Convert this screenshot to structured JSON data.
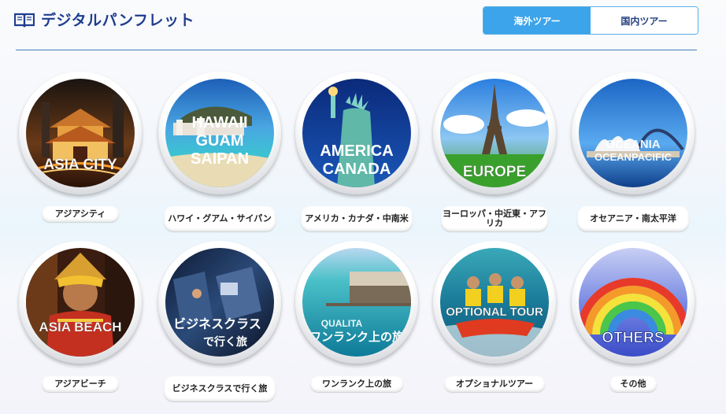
{
  "header": {
    "title": "デジタルパンフレット",
    "icon": "open-book-icon"
  },
  "tabs": [
    {
      "label": "海外ツアー",
      "active": true
    },
    {
      "label": "国内ツアー",
      "active": false
    }
  ],
  "colors": {
    "accent": "#3ba4ea",
    "title": "#1f3d8f",
    "divider": "#3f7fb5"
  },
  "destinations": [
    {
      "id": "asia-city",
      "overlay": [
        "ASIA CITY"
      ],
      "caption": "アジアシティ"
    },
    {
      "id": "hawaii",
      "overlay": [
        "HAWAII",
        "GUAM",
        "SAIPAN"
      ],
      "caption": "ハワイ・グアム・サイパン"
    },
    {
      "id": "america",
      "overlay": [
        "AMERICA",
        "CANADA"
      ],
      "caption": "アメリカ・カナダ・中南米"
    },
    {
      "id": "europe",
      "overlay": [
        "EUROPE"
      ],
      "caption": "ヨーロッパ・中近東・アフリカ"
    },
    {
      "id": "oceania",
      "overlay": [
        "OCEANIA",
        "OCEANPACIFIC"
      ],
      "caption": "オセアニア・南太平洋"
    },
    {
      "id": "asia-beach",
      "overlay": [
        "ASIA BEACH"
      ],
      "caption": "アジアビーチ"
    },
    {
      "id": "business",
      "overlay": [
        "ビジネスクラス",
        "で行く旅"
      ],
      "caption": "ビジネスクラスで行く旅"
    },
    {
      "id": "qualita",
      "overlay": [
        "QUALITA",
        "ワンランク上の旅"
      ],
      "caption": "ワンランク上の旅"
    },
    {
      "id": "optional",
      "overlay": [
        "OPTIONAL TOUR"
      ],
      "caption": "オプショナルツアー"
    },
    {
      "id": "others",
      "overlay": [
        "OTHERS"
      ],
      "caption": "その他"
    }
  ]
}
